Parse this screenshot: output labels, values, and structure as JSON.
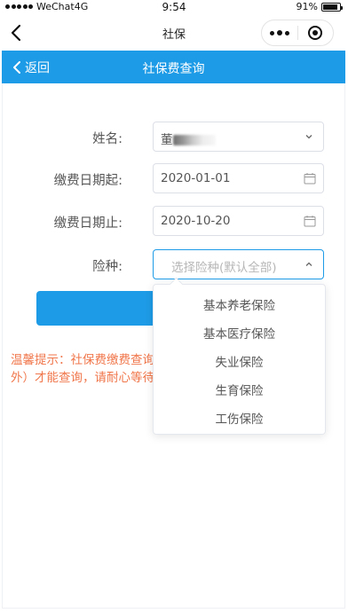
{
  "status_bar": {
    "carrier": "WeChat4G",
    "time": "9:54",
    "battery_text": "91%",
    "battery_level": 0.91
  },
  "wechat_nav": {
    "title": "社保",
    "back_icon": "chevron-left-icon",
    "more_icon": "more-dots-icon",
    "close_icon": "target-close-icon"
  },
  "header": {
    "back_label": "返回",
    "title": "社保费查询"
  },
  "form": {
    "name_label": "姓名:",
    "name_value_visible": "董",
    "start_label": "缴费日期起:",
    "start_value": "2020-01-01",
    "end_label": "缴费日期止:",
    "end_value": "2020-10-20",
    "type_label": "险种:",
    "type_placeholder": "选择险种(默认全部)"
  },
  "dropdown": {
    "options": [
      "基本养老保险",
      "基本医疗保险",
      "失业保险",
      "生育保险",
      "工伤保险"
    ]
  },
  "tip": {
    "line1": "温馨提示：社保费缴费查询",
    "line2": "外）才能查询，请耐心等待"
  },
  "colors": {
    "accent": "#1e9be6",
    "tip": "#f0764a",
    "border": "#dcdfe6"
  }
}
